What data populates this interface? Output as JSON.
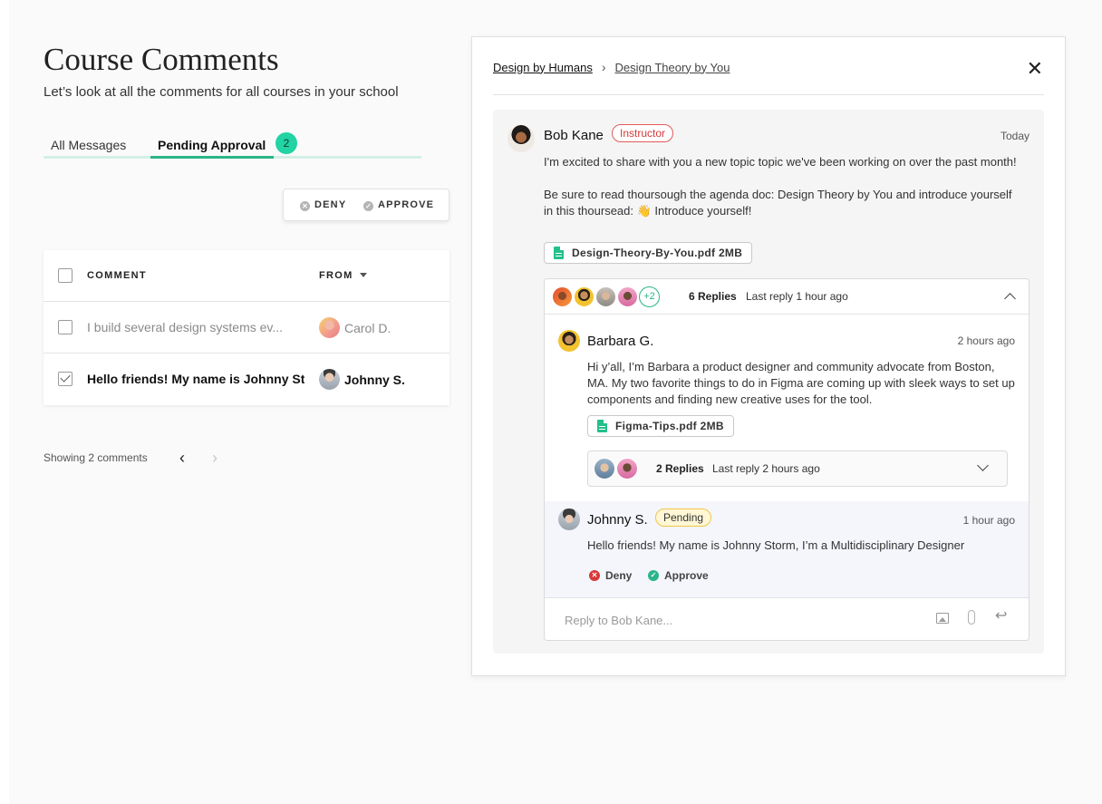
{
  "page": {
    "title": "Course Comments",
    "subtitle": "Let’s look at all the comments for all courses in your school"
  },
  "tabs": {
    "all_messages": "All Messages",
    "pending_approval": "Pending Approval",
    "pending_count": "2"
  },
  "bulk_actions": {
    "deny": "DENY",
    "approve": "APPROVE"
  },
  "table": {
    "headers": {
      "comment": "COMMENT",
      "from": "FROM"
    },
    "rows": [
      {
        "comment": "I build several design systems ev...",
        "from": "Carol D.",
        "checked": false
      },
      {
        "comment": "Hello friends! My name is Johnny Storm",
        "from": "Johnny S.",
        "checked": true
      }
    ]
  },
  "pagination": {
    "showing": "Showing 2 comments",
    "prev": "‹",
    "next": "›"
  },
  "panel": {
    "breadcrumb": [
      "Design by Humans",
      "Design Theory by You"
    ],
    "close": "✕",
    "post": {
      "author": "Bob Kane",
      "role": "Instructor",
      "time": "Today",
      "body_1": "I'm excited to share with you a new topic topic we've been working on over the past month!",
      "body_2": "Be sure to read thoursough the agenda doc: Design Theory by You and introduce yourself in this thoursead: 👋 Introduce yourself!",
      "attachment": "Design-Theory-By-You.pdf 2MB"
    },
    "replies": {
      "extra_count": "+2",
      "count": "6 Replies",
      "last_reply": "Last reply 1 hour ago"
    },
    "reply_1": {
      "author": "Barbara G.",
      "time": "2 hours ago",
      "body": "Hi y’all, I’m Barbara a product designer and community advocate from Boston, MA. My two favorite things to do in Figma are coming up with sleek ways to set up components and finding new creative uses for the tool.",
      "attachment": "Figma-Tips.pdf 2MB",
      "sub_replies": {
        "count": "2 Replies",
        "last_reply": "Last reply 2 hours ago"
      }
    },
    "pending_reply": {
      "author": "Johnny S.",
      "status": "Pending",
      "time": "1 hour ago",
      "body": "Hello friends! My name is Johnny Storm, I’m a Multidisciplinary Designer",
      "deny": "Deny",
      "approve": "Approve"
    },
    "composer": {
      "placeholder": "Reply to Bob Kane..."
    }
  },
  "colors": {
    "accent": "#2bb589",
    "badge": "#22d3a3",
    "instructor": "#d63a3a",
    "pending": "#f0c54a"
  }
}
